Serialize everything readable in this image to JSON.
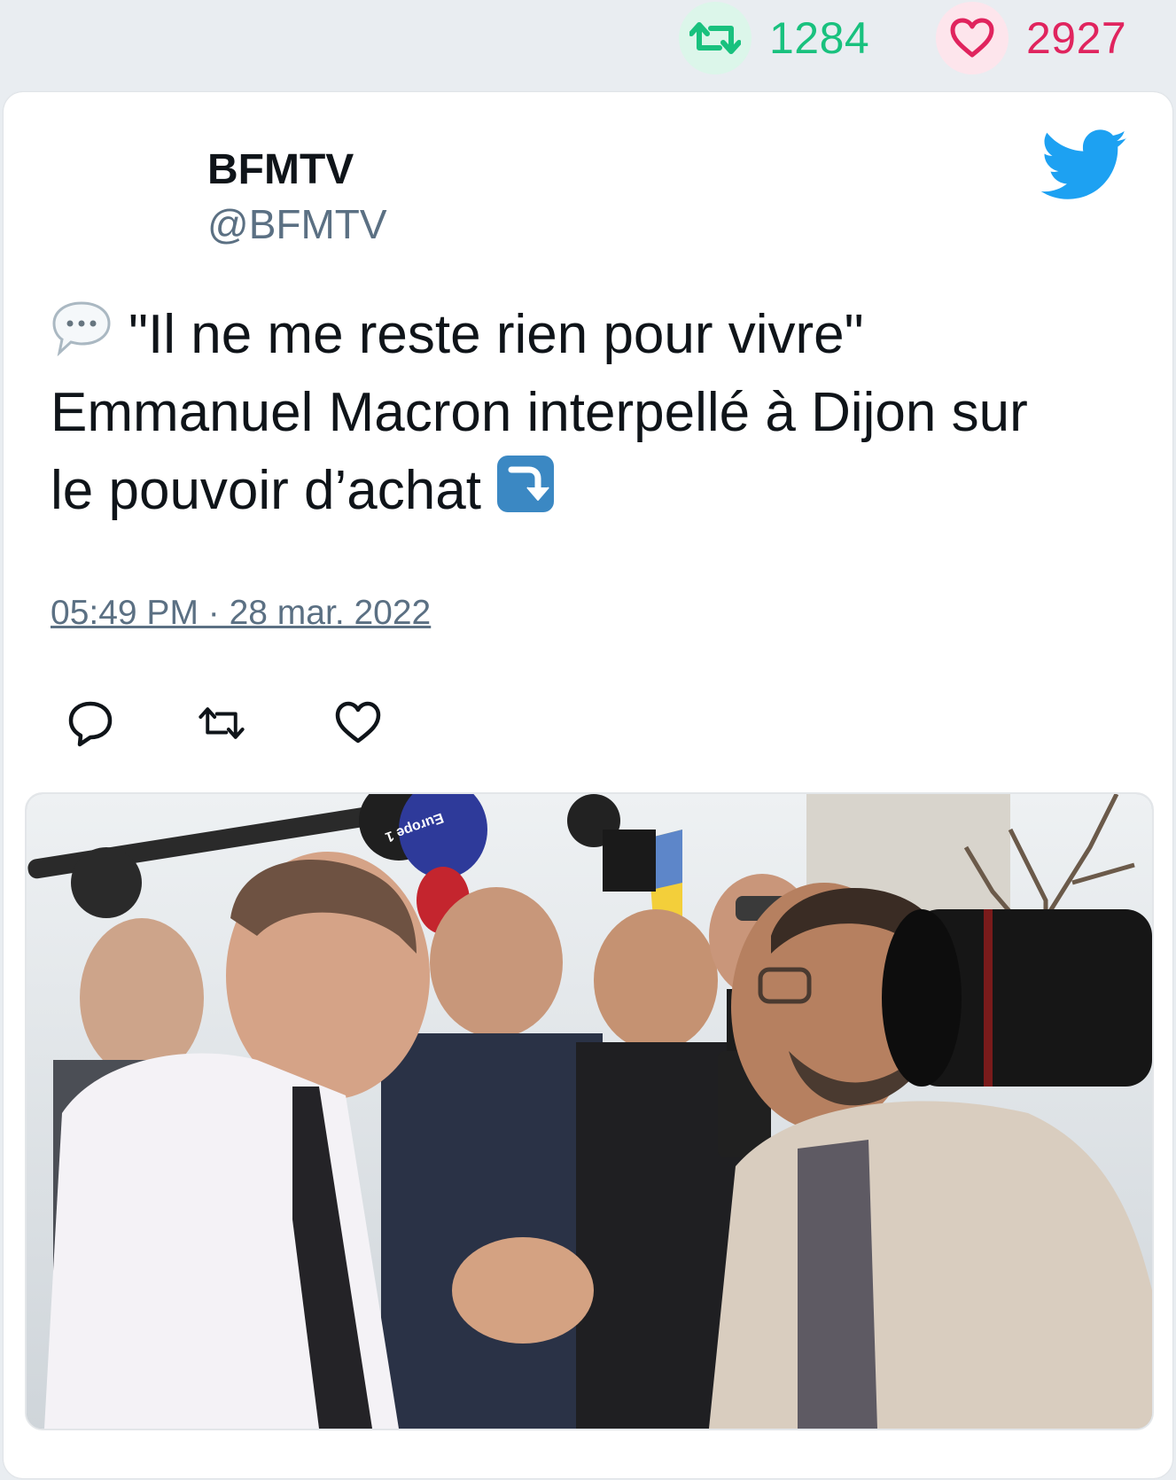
{
  "stats": {
    "retweet_count": "1284",
    "like_count": "2927"
  },
  "tweet": {
    "author_name": "BFMTV",
    "author_handle": "@BFMTV",
    "text_line_1": "\"Il ne me reste rien pour vivre\"",
    "text_line_2": "Emmanuel Macron interpellé à Dijon sur",
    "text_line_3": "le pouvoir d’achat",
    "timestamp": "05:49 PM · 28 mar. 2022",
    "media": {
      "microphone_brand": "Europe 1"
    }
  },
  "icons": {
    "retweet": "retweet-icon",
    "like": "heart-icon",
    "reply": "reply-icon",
    "brand": "twitter-bird-icon",
    "speech": "speech-bubble-emoji",
    "arrow": "arrow-down-right-emoji"
  },
  "colors": {
    "retweet_green": "#19c17e",
    "like_red": "#e0245e",
    "twitter_blue": "#1da1f2",
    "secondary_text": "#5b7083"
  }
}
